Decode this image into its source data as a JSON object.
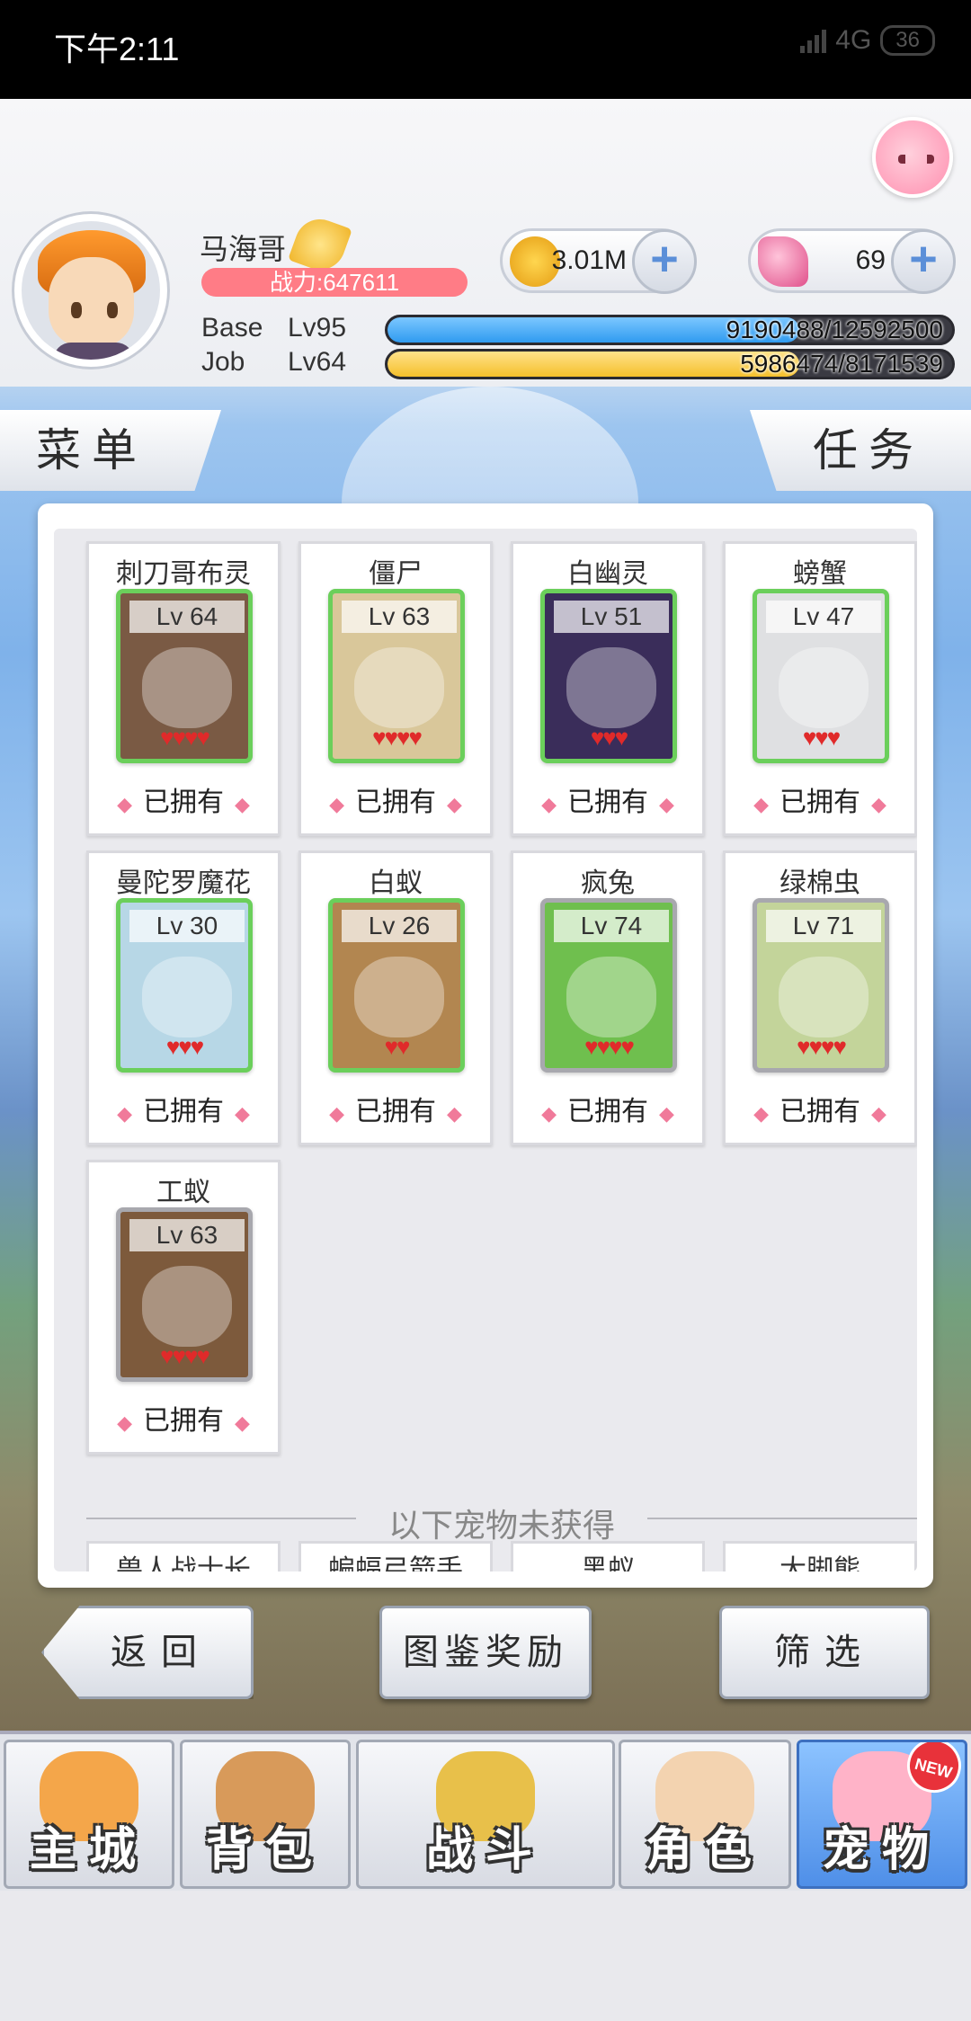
{
  "status_bar": {
    "time": "下午2:11",
    "network": "4G",
    "battery": "36"
  },
  "player": {
    "name": "马海哥",
    "power": "战力:647611",
    "base_label": "Base",
    "base_level": "Lv95",
    "base_exp": "9190488/12592500",
    "base_fraction": 0.73,
    "job_label": "Job",
    "job_level": "Lv64",
    "job_exp": "5986474/8171539",
    "job_fraction": 0.73
  },
  "currency": {
    "gold": "3.01M",
    "gems": "69",
    "plus": "+"
  },
  "tabs": {
    "menu": "菜单",
    "task": "任务"
  },
  "owned_label": "已拥有",
  "owned_pets": [
    {
      "name": "刺刀哥布灵",
      "level": "Lv 64",
      "hearts": "♥♥♥♥",
      "frame": "green",
      "bg": "#7a5a44"
    },
    {
      "name": "僵尸",
      "level": "Lv 63",
      "hearts": "♥♥♥♥",
      "frame": "green",
      "bg": "#d9c79a"
    },
    {
      "name": "白幽灵",
      "level": "Lv 51",
      "hearts": "♥♥♥",
      "frame": "green",
      "bg": "#3a2d5a"
    },
    {
      "name": "螃蟹",
      "level": "Lv 47",
      "hearts": "♥♥♥",
      "frame": "green",
      "bg": "#dfe0e2"
    },
    {
      "name": "曼陀罗魔花",
      "level": "Lv 30",
      "hearts": "♥♥♥",
      "frame": "green",
      "bg": "#b7d7e6"
    },
    {
      "name": "白蚁",
      "level": "Lv 26",
      "hearts": "♥♥",
      "frame": "green",
      "bg": "#b28650"
    },
    {
      "name": "疯兔",
      "level": "Lv 74",
      "hearts": "♥♥♥♥",
      "frame": "grey",
      "bg": "#6fbf4e"
    },
    {
      "name": "绿棉虫",
      "level": "Lv 71",
      "hearts": "♥♥♥♥",
      "frame": "grey",
      "bg": "#c3d49a"
    },
    {
      "name": "工蚁",
      "level": "Lv 63",
      "hearts": "♥♥♥♥",
      "frame": "grey",
      "bg": "#7d5a3c"
    }
  ],
  "divider_text": "以下宠物未获得",
  "locked_pets": [
    "兽人战士长",
    "蝙蝠弓箭手",
    "黑蚁",
    "大脚熊"
  ],
  "buttons": {
    "back": "返回",
    "collection_reward": "图鉴奖励",
    "filter": "筛选"
  },
  "nav": [
    {
      "label": "主城",
      "icon": "castle-icon"
    },
    {
      "label": "背包",
      "icon": "backpack-icon"
    },
    {
      "label": "战斗",
      "icon": "battle-icon"
    },
    {
      "label": "角色",
      "icon": "character-icon"
    },
    {
      "label": "宠物",
      "icon": "pet-icon",
      "badge": "NEW"
    }
  ],
  "colors": {
    "exp_base": "#2f9bf0",
    "exp_job": "#f5c02b",
    "owned_frame": "#6bcf5b",
    "active_nav": "#4f8fe8"
  }
}
